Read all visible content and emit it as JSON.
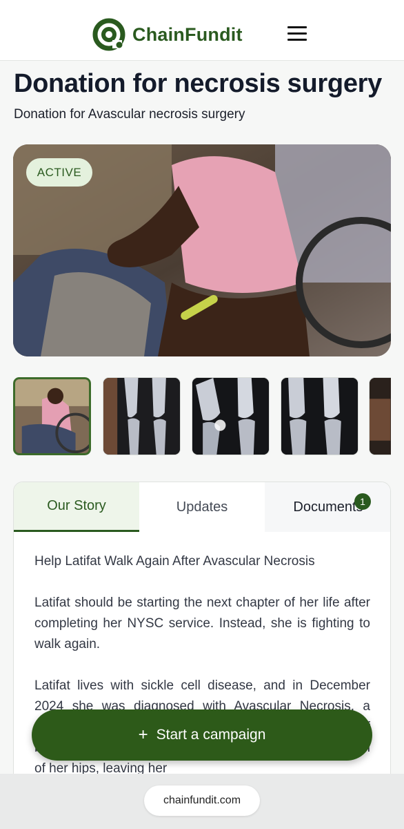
{
  "header": {
    "brand": "ChainFundit",
    "logo_icon": "chainfundit-logo-icon",
    "menu_icon": "hamburger-menu-icon"
  },
  "campaign": {
    "title": "Donation for necrosis surgery",
    "subtitle": "Donation for Avascular necrosis surgery",
    "status": "ACTIVE"
  },
  "gallery": {
    "thumbnails": [
      "photo-patient-wheelchair",
      "xray-knee-1",
      "xray-knee-2",
      "xray-knee-3",
      "photo-partial"
    ]
  },
  "tabs": [
    {
      "label": "Our Story",
      "active": true
    },
    {
      "label": "Updates",
      "active": false
    },
    {
      "label": "Documents",
      "active": false,
      "count": "1"
    }
  ],
  "story": {
    "paragraphs": [
      "Help Latifat Walk Again After Avascular Necrosis",
      "Latifat should be starting the next chapter of her life after completing her NYSC service. Instead, she is fighting to walk again.",
      "Latifat lives with sickle cell disease, and in December 2024 she was diagnosed with Avascular Necrosis, a painful condition where the bone tissue dies due to lack of blood supply. The condition has severely damaged both of her hips, leaving her"
    ]
  },
  "cta": {
    "label": "Start a campaign",
    "icon": "plus-icon"
  },
  "browser": {
    "url": "chainfundit.com"
  },
  "colors": {
    "brand_green": "#2a5a1f",
    "cta_green": "#2d5a19",
    "badge_bg": "#e4f1dd"
  }
}
